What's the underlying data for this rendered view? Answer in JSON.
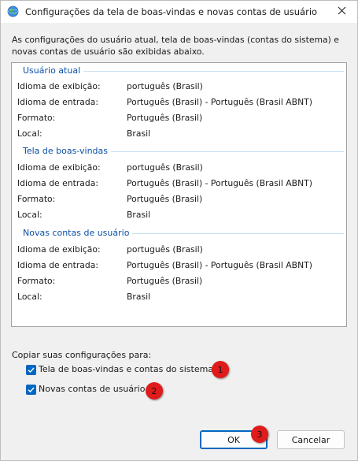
{
  "window": {
    "title": "Configurações da tela de boas-vindas e novas contas de usuário",
    "icon": "globe-settings-icon",
    "close_icon": "close-icon"
  },
  "intro": "As configurações do usuário atual, tela de boas-vindas (contas do sistema) e novas contas de usuário são exibidas abaixo.",
  "sections": [
    {
      "title": "Usuário atual",
      "rows": [
        {
          "label": "Idioma de exibição:",
          "value": "português (Brasil)"
        },
        {
          "label": "Idioma de entrada:",
          "value": "Português (Brasil) - Português (Brasil ABNT)"
        },
        {
          "label": "Formato:",
          "value": "Português (Brasil)"
        },
        {
          "label": "Local:",
          "value": "Brasil"
        }
      ]
    },
    {
      "title": "Tela de boas-vindas",
      "rows": [
        {
          "label": "Idioma de exibição:",
          "value": "português (Brasil)"
        },
        {
          "label": "Idioma de entrada:",
          "value": "Português (Brasil) - Português (Brasil ABNT)"
        },
        {
          "label": "Formato:",
          "value": "Português (Brasil)"
        },
        {
          "label": "Local:",
          "value": "Brasil"
        }
      ]
    },
    {
      "title": "Novas contas de usuário",
      "rows": [
        {
          "label": "Idioma de exibição:",
          "value": "português (Brasil)"
        },
        {
          "label": "Idioma de entrada:",
          "value": "Português (Brasil) - Português (Brasil ABNT)"
        },
        {
          "label": "Formato:",
          "value": "Português (Brasil)"
        },
        {
          "label": "Local:",
          "value": "Brasil"
        }
      ]
    }
  ],
  "copy": {
    "label": "Copiar suas configurações para:",
    "options": [
      {
        "label": "Tela de boas-vindas e contas do sistema",
        "checked": true,
        "badge": "1"
      },
      {
        "label": "Novas contas de usuário",
        "checked": true,
        "badge": "2"
      }
    ]
  },
  "buttons": {
    "ok": "OK",
    "cancel": "Cancelar",
    "ok_badge": "3"
  },
  "colors": {
    "accent": "#0067c0",
    "section_title": "#0b4fa8",
    "badge": "#e01b1b"
  }
}
